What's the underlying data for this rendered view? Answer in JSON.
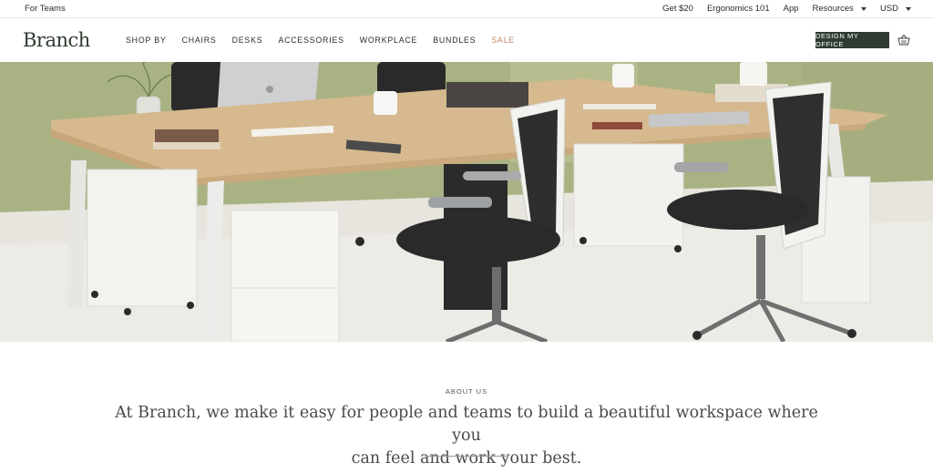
{
  "utility": {
    "left_label": "For Teams",
    "links": [
      "Get $20",
      "Ergonomics 101",
      "App"
    ],
    "resources_label": "Resources",
    "currency_label": "USD"
  },
  "nav": {
    "logo": "Branch",
    "links": [
      "SHOP BY",
      "CHAIRS",
      "DESKS",
      "ACCESSORIES",
      "WORKPLACE",
      "BUNDLES"
    ],
    "sale_label": "SALE",
    "cta_label": "DESIGN MY OFFICE",
    "cart_icon": "basket-icon"
  },
  "about": {
    "kicker": "ABOUT US",
    "line1": "At Branch, we make it easy for people and teams to build a beautiful workspace where you",
    "line2": "can feel and work your best."
  },
  "colors": {
    "brand_dark": "#2f3b33",
    "sale": "#c38a67",
    "wall_green": "#a9b283"
  }
}
